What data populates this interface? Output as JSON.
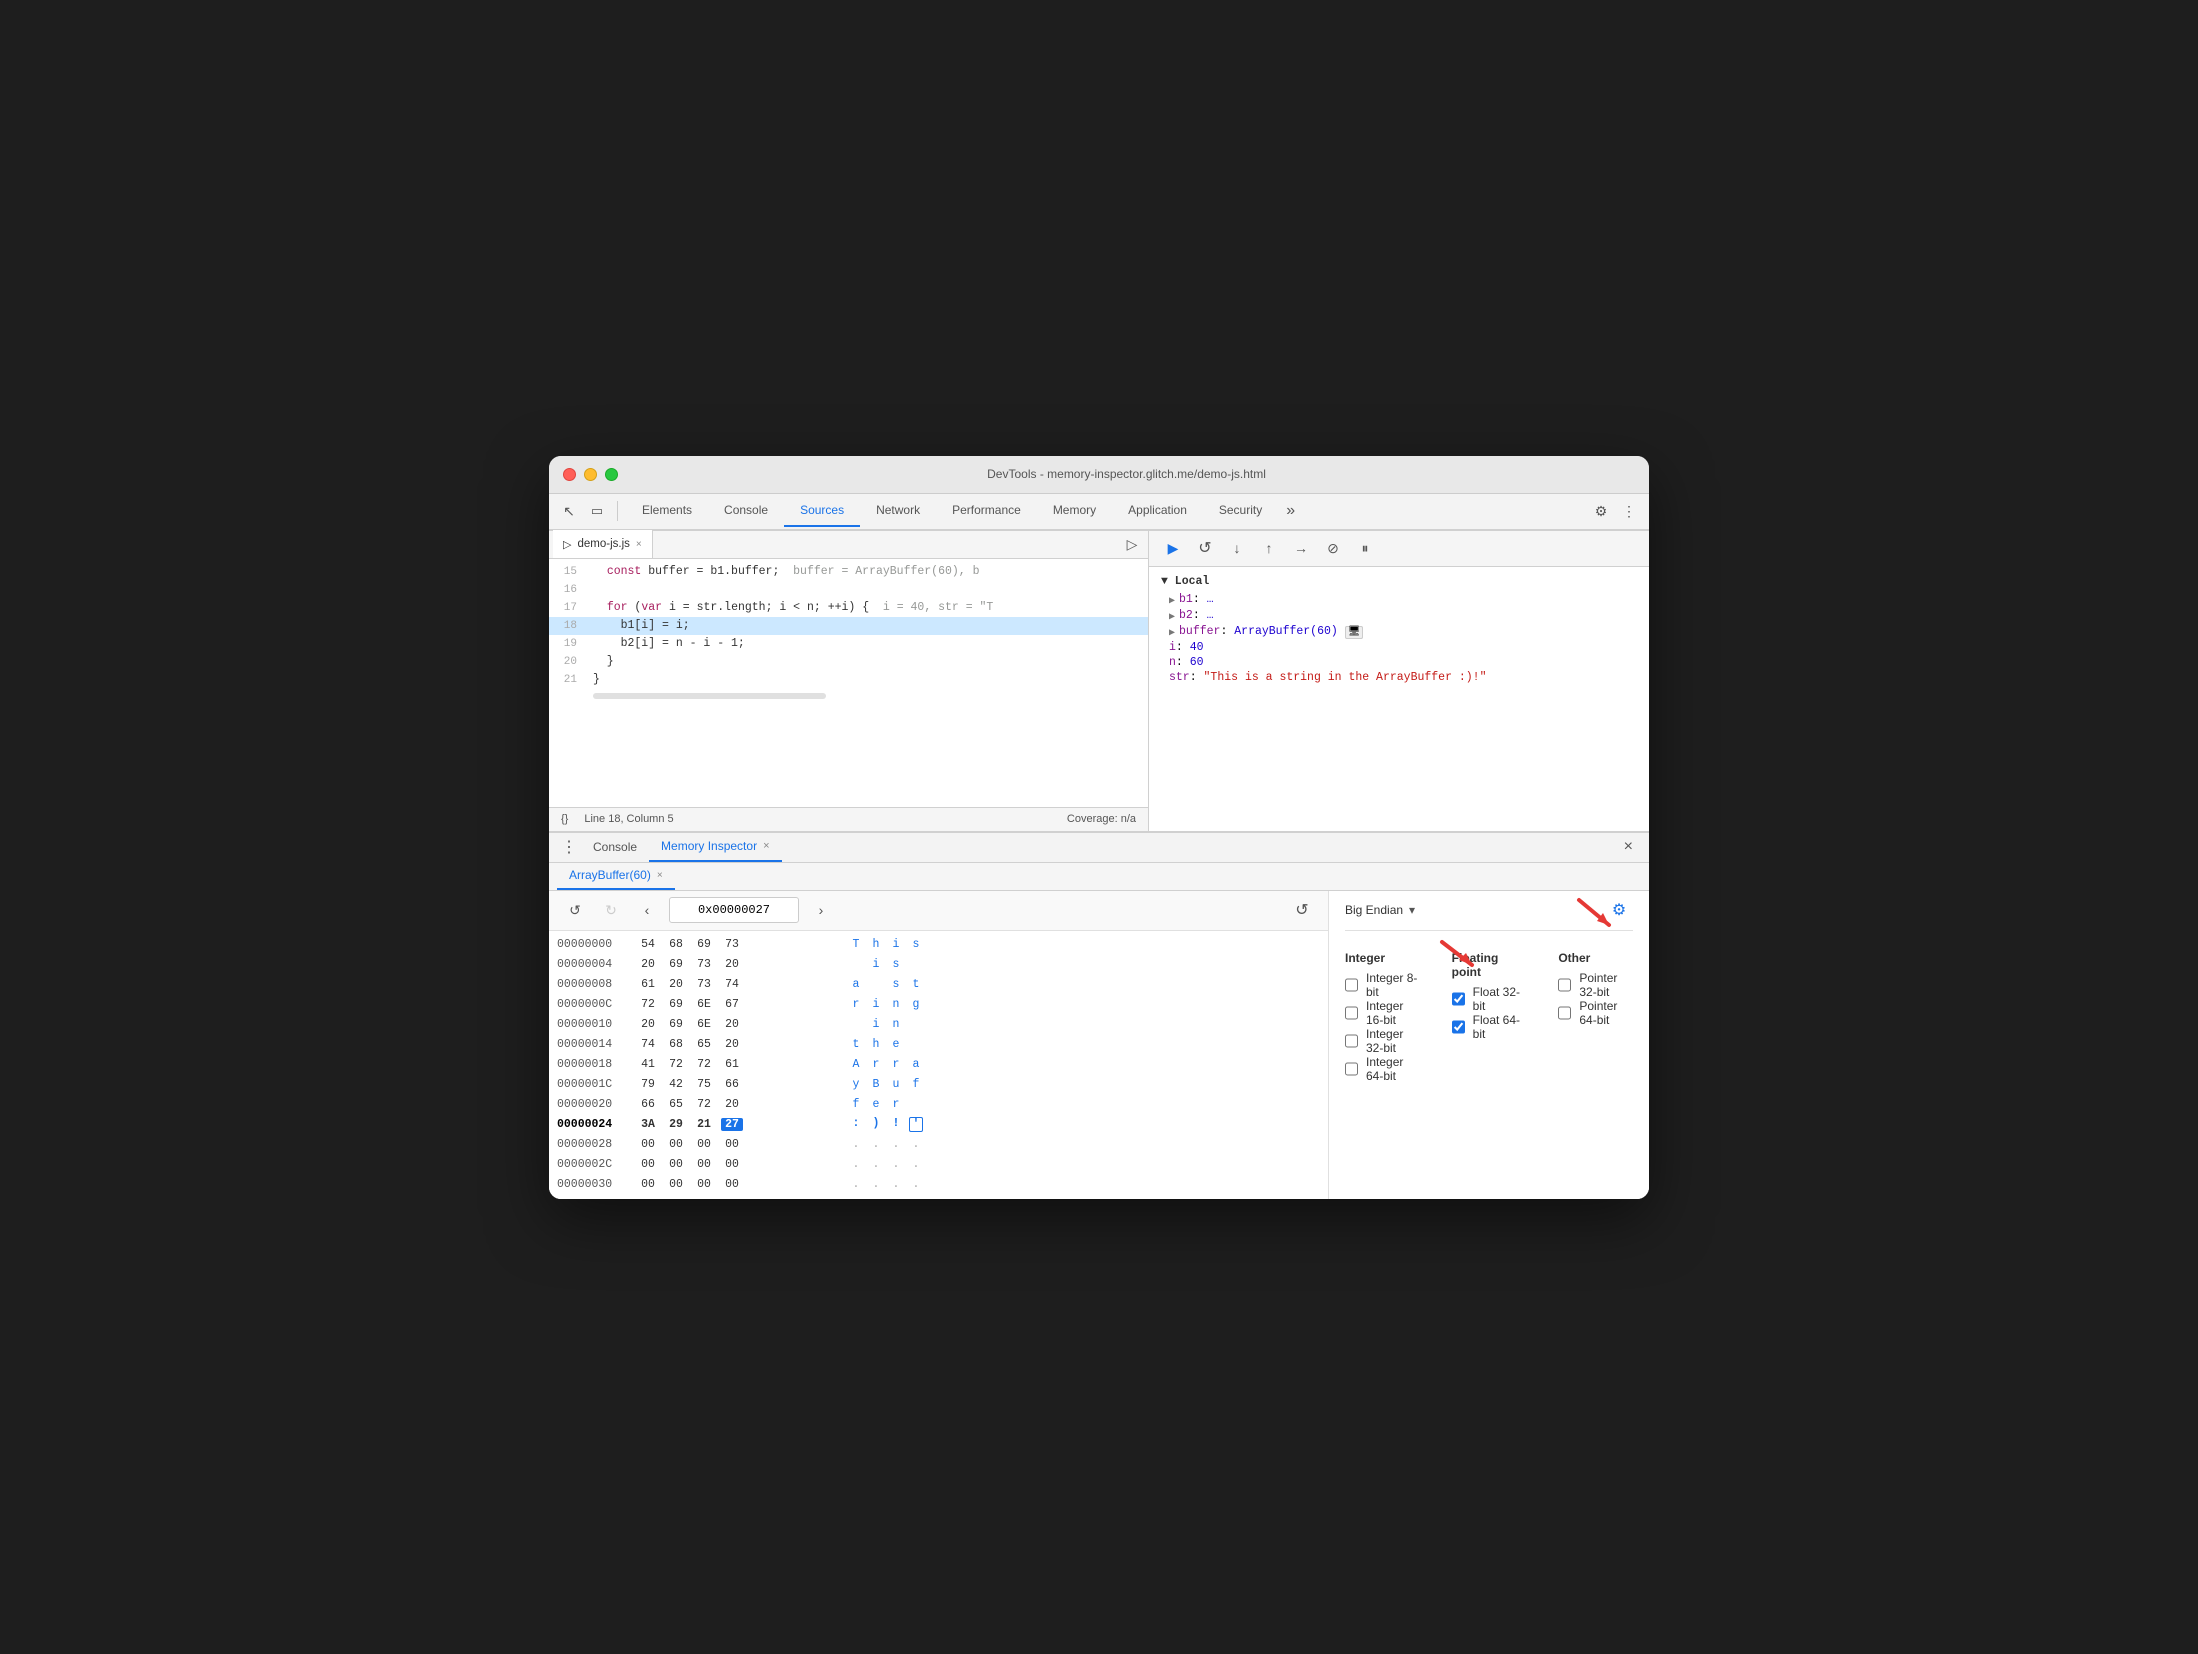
{
  "window": {
    "title": "DevTools - memory-inspector.glitch.me/demo-js.html"
  },
  "titlebar": {
    "close": "●",
    "minimize": "●",
    "maximize": "●"
  },
  "tabs": {
    "items": [
      "Elements",
      "Console",
      "Sources",
      "Network",
      "Performance",
      "Memory",
      "Application",
      "Security"
    ],
    "active": "Sources",
    "more": "»"
  },
  "file_tab": {
    "name": "demo-js.js",
    "close": "×"
  },
  "code": {
    "lines": [
      {
        "num": "15",
        "content": "  const buffer = b1.buffer;  buffer = ArrayBuffer(60), b",
        "highlighted": false
      },
      {
        "num": "16",
        "content": "",
        "highlighted": false
      },
      {
        "num": "17",
        "content": "  for (var i = str.length; i < n; ++i) {  i = 40, str = \"T",
        "highlighted": false
      },
      {
        "num": "18",
        "content": "    b1[i] = i;",
        "highlighted": true
      },
      {
        "num": "19",
        "content": "    b2[i] = n - i - 1;",
        "highlighted": false
      },
      {
        "num": "20",
        "content": "  }",
        "highlighted": false
      },
      {
        "num": "21",
        "content": "}",
        "highlighted": false
      }
    ]
  },
  "status_bar": {
    "position": "Line 18, Column 5",
    "coverage": "Coverage: n/a"
  },
  "debug_toolbar": {
    "buttons": [
      "▶",
      "↺",
      "↓",
      "↑",
      "→|",
      "⊘",
      "⏸"
    ]
  },
  "scope": {
    "title": "▼ Local",
    "items": [
      {
        "key": "b1",
        "val": "…"
      },
      {
        "key": "b2",
        "val": "…"
      },
      {
        "key": "buffer",
        "val": "ArrayBuffer(60) 🖥"
      },
      {
        "key": "i",
        "val": "40"
      },
      {
        "key": "n",
        "val": "60"
      },
      {
        "key": "str",
        "val": "\"This is a string in the ArrayBuffer :)!\""
      }
    ]
  },
  "bottom_tabs": {
    "menu_icon": "⋮",
    "items": [
      "Console",
      "Memory Inspector"
    ],
    "active": "Memory Inspector",
    "close": "×"
  },
  "memory_inspector": {
    "buffer_tab": "ArrayBuffer(60)",
    "nav": {
      "back": "⟲",
      "forward": "↻",
      "prev": "‹",
      "next": "›",
      "address": "0x00000027",
      "refresh": "↺"
    },
    "endian": {
      "label": "Big Endian",
      "arrow": "▾"
    },
    "hex_rows": [
      {
        "addr": "00000000",
        "bytes": [
          "54",
          "68",
          "69",
          "73"
        ],
        "chars": [
          "T",
          "h",
          "i",
          "s"
        ],
        "selected": -1
      },
      {
        "addr": "00000004",
        "bytes": [
          "20",
          "69",
          "73",
          "20"
        ],
        "chars": [
          " ",
          "i",
          "s",
          " "
        ],
        "selected": -1
      },
      {
        "addr": "00000008",
        "bytes": [
          "61",
          "20",
          "73",
          "74"
        ],
        "chars": [
          "a",
          " ",
          "s",
          "t"
        ],
        "selected": -1
      },
      {
        "addr": "0000000C",
        "bytes": [
          "72",
          "69",
          "6E",
          "67"
        ],
        "chars": [
          "r",
          "i",
          "n",
          "g"
        ],
        "selected": -1
      },
      {
        "addr": "00000010",
        "bytes": [
          "20",
          "69",
          "6E",
          "20"
        ],
        "chars": [
          " ",
          "i",
          "n",
          " "
        ],
        "selected": -1
      },
      {
        "addr": "00000014",
        "bytes": [
          "74",
          "68",
          "65",
          "20"
        ],
        "chars": [
          "t",
          "h",
          "e",
          " "
        ],
        "selected": -1
      },
      {
        "addr": "00000018",
        "bytes": [
          "41",
          "72",
          "72",
          "61"
        ],
        "chars": [
          "A",
          "r",
          "r",
          "a"
        ],
        "selected": -1
      },
      {
        "addr": "0000001C",
        "bytes": [
          "79",
          "42",
          "75",
          "66"
        ],
        "chars": [
          "y",
          "B",
          "u",
          "f"
        ],
        "selected": -1
      },
      {
        "addr": "00000020",
        "bytes": [
          "66",
          "65",
          "72",
          "20"
        ],
        "chars": [
          "f",
          "e",
          "r",
          " "
        ],
        "selected": -1
      },
      {
        "addr": "00000024",
        "bytes": [
          "3A",
          "29",
          "21",
          "27"
        ],
        "chars": [
          ":",
          ")",
          "!",
          "'"
        ],
        "selected": 3,
        "current": true
      },
      {
        "addr": "00000028",
        "bytes": [
          "00",
          "00",
          "00",
          "00"
        ],
        "chars": [
          ".",
          ".",
          ".",
          "."
        ],
        "selected": -1
      },
      {
        "addr": "0000002C",
        "bytes": [
          "00",
          "00",
          "00",
          "00"
        ],
        "chars": [
          ".",
          ".",
          ".",
          "."
        ],
        "selected": -1
      },
      {
        "addr": "00000030",
        "bytes": [
          "00",
          "00",
          "00",
          "00"
        ],
        "chars": [
          ".",
          ".",
          ".",
          "."
        ],
        "selected": -1
      }
    ],
    "settings": {
      "endian_label": "Big Endian",
      "sections": [
        {
          "title": "Integer",
          "items": [
            {
              "label": "Integer 8-bit",
              "checked": false
            },
            {
              "label": "Integer 16-bit",
              "checked": false
            },
            {
              "label": "Integer 32-bit",
              "checked": false
            },
            {
              "label": "Integer 64-bit",
              "checked": false
            }
          ]
        },
        {
          "title": "Floating point",
          "items": [
            {
              "label": "Float 32-bit",
              "checked": true
            },
            {
              "label": "Float 64-bit",
              "checked": true
            }
          ]
        },
        {
          "title": "Other",
          "items": [
            {
              "label": "Pointer 32-bit",
              "checked": false
            },
            {
              "label": "Pointer 64-bit",
              "checked": false
            }
          ]
        }
      ]
    }
  },
  "close_icon": "×",
  "gear_icon": "⚙"
}
